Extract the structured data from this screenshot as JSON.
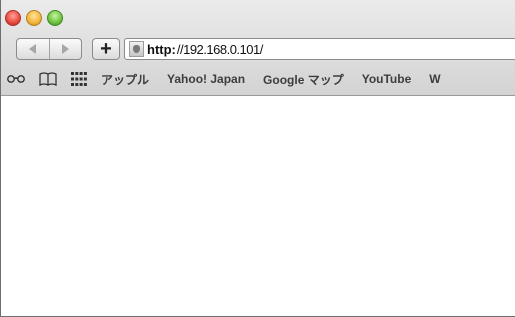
{
  "toolbar": {
    "back_icon": "back-arrow-icon",
    "forward_icon": "forward-arrow-icon",
    "add_label": "+"
  },
  "address_bar": {
    "scheme": "http:",
    "host": "//192.168.0.101/"
  },
  "bookmarks": {
    "items": [
      {
        "label": "アップル"
      },
      {
        "label": "Yahoo! Japan"
      },
      {
        "label": "Google マップ"
      },
      {
        "label": "YouTube"
      },
      {
        "label": "W"
      }
    ]
  }
}
